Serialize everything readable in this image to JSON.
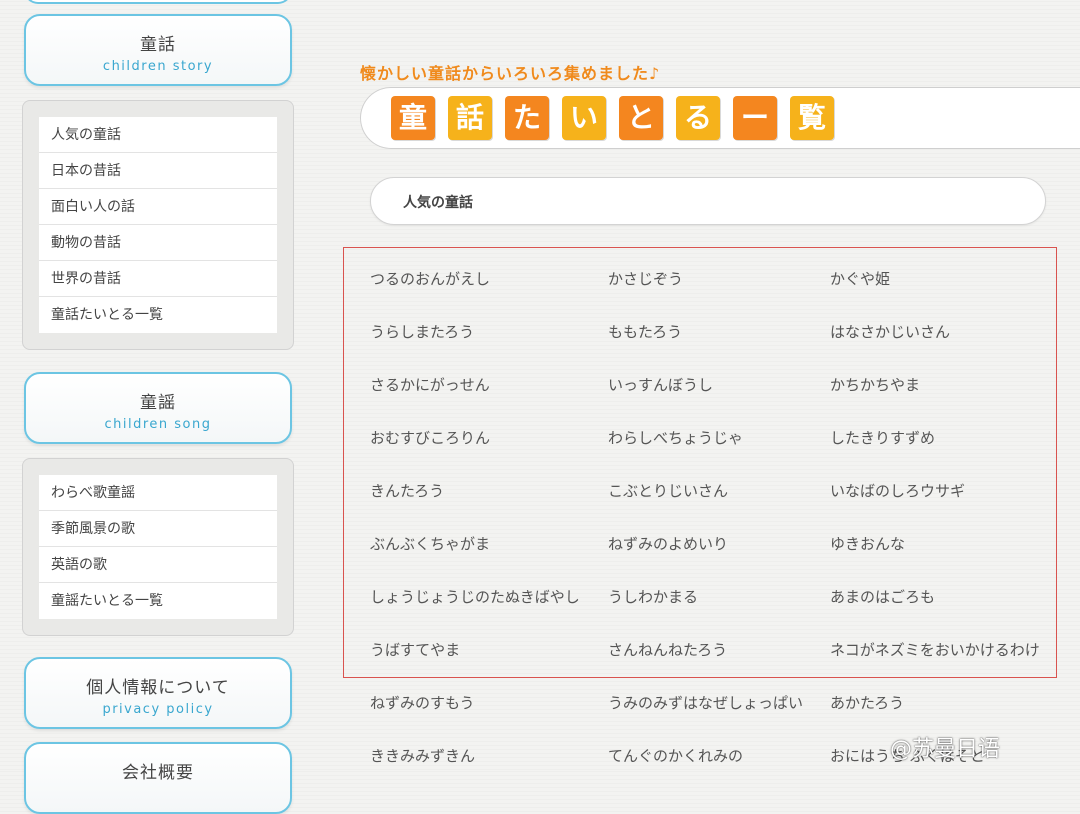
{
  "sidebar": {
    "story": {
      "jp": "童話",
      "en": "children story"
    },
    "story_menu": [
      "人気の童話",
      "日本の昔話",
      "面白い人の話",
      "動物の昔話",
      "世界の昔話",
      "童話たいとる一覧"
    ],
    "song": {
      "jp": "童謡",
      "en": "children song"
    },
    "song_menu": [
      "わらべ歌童謡",
      "季節風景の歌",
      "英語の歌",
      "童謡たいとる一覧"
    ],
    "privacy": {
      "jp": "個人情報について",
      "en": "privacy policy"
    },
    "company": {
      "jp": "会社概要"
    }
  },
  "main": {
    "tagline": "懐かしい童話からいろいろ集めました♪",
    "title_chars": [
      "童",
      "話",
      "た",
      "い",
      "と",
      "る",
      "ー",
      "覧"
    ],
    "section_title": "人気の童話",
    "rows": [
      [
        "つるのおんがえし",
        "かさじぞう",
        "かぐや姫"
      ],
      [
        "うらしまたろう",
        "ももたろう",
        "はなさかじいさん"
      ],
      [
        "さるかにがっせん",
        "いっすんぼうし",
        "かちかちやま"
      ],
      [
        "おむすびころりん",
        "わらしべちょうじゃ",
        "したきりすずめ"
      ],
      [
        "きんたろう",
        "こぶとりじいさん",
        "いなばのしろウサギ"
      ],
      [
        "ぶんぶくちゃがま",
        "ねずみのよめいり",
        "ゆきおんな"
      ],
      [
        "しょうじょうじのたぬきばやし",
        "うしわかまる",
        "あまのはごろも"
      ],
      [
        "うばすてやま",
        "さんねんねたろう",
        "ネコがネズミをおいかけるわけ"
      ],
      [
        "ねずみのすもう",
        "うみのみずはなぜしょっぱい",
        "あかたろう"
      ],
      [
        "ききみみずきん",
        "てんぐのかくれみの",
        "おにはうち ふくはそと"
      ]
    ]
  },
  "watermark": "@苏曼日语",
  "colors": {
    "accent_blue": "#6cc5e3",
    "title_orange": "#f4861f",
    "title_yellow": "#f6b21b",
    "highlight_red": "#d9534f"
  }
}
